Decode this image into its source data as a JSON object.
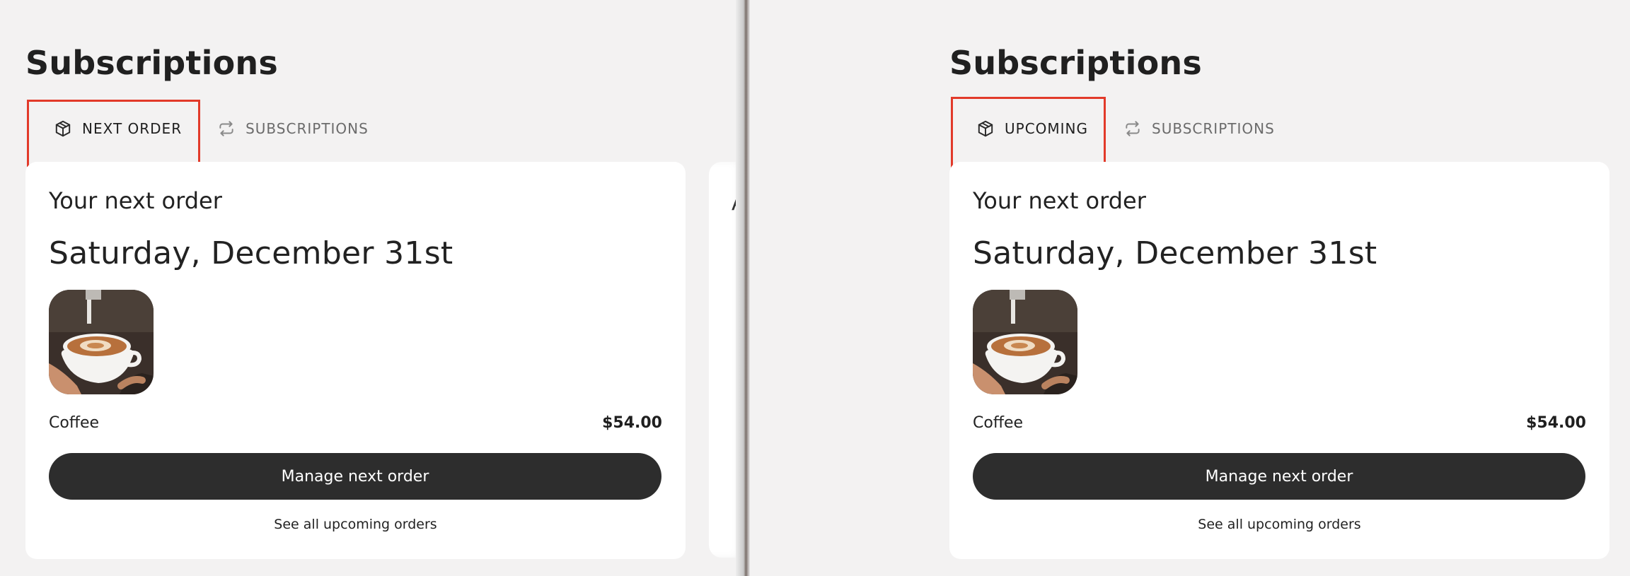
{
  "left_panel": {
    "page_title": "Subscriptions",
    "tabs": [
      {
        "label": "NEXT ORDER",
        "icon": "package-icon",
        "active": true
      },
      {
        "label": "SUBSCRIPTIONS",
        "icon": "repeat-icon",
        "active": false
      }
    ],
    "card": {
      "heading": "Your next order",
      "date": "Saturday, December 31st",
      "product": {
        "name": "Coffee",
        "price": "$54.00",
        "image": "latte-art-coffee-cup"
      },
      "primary_button": "Manage next order",
      "secondary_link": "See all upcoming orders"
    },
    "peek_text": "A"
  },
  "right_panel": {
    "page_title": "Subscriptions",
    "tabs": [
      {
        "label": "UPCOMING",
        "icon": "package-icon",
        "active": true
      },
      {
        "label": "SUBSCRIPTIONS",
        "icon": "repeat-icon",
        "active": false
      }
    ],
    "card": {
      "heading": "Your next order",
      "date": "Saturday, December 31st",
      "product": {
        "name": "Coffee",
        "price": "$54.00",
        "image": "latte-art-coffee-cup"
      },
      "primary_button": "Manage next order",
      "secondary_link": "See all upcoming orders"
    }
  },
  "colors": {
    "page_background": "#f3f2f2",
    "card_background": "#ffffff",
    "button_background": "#2d2d2d",
    "highlight_border": "#e23a2a"
  }
}
